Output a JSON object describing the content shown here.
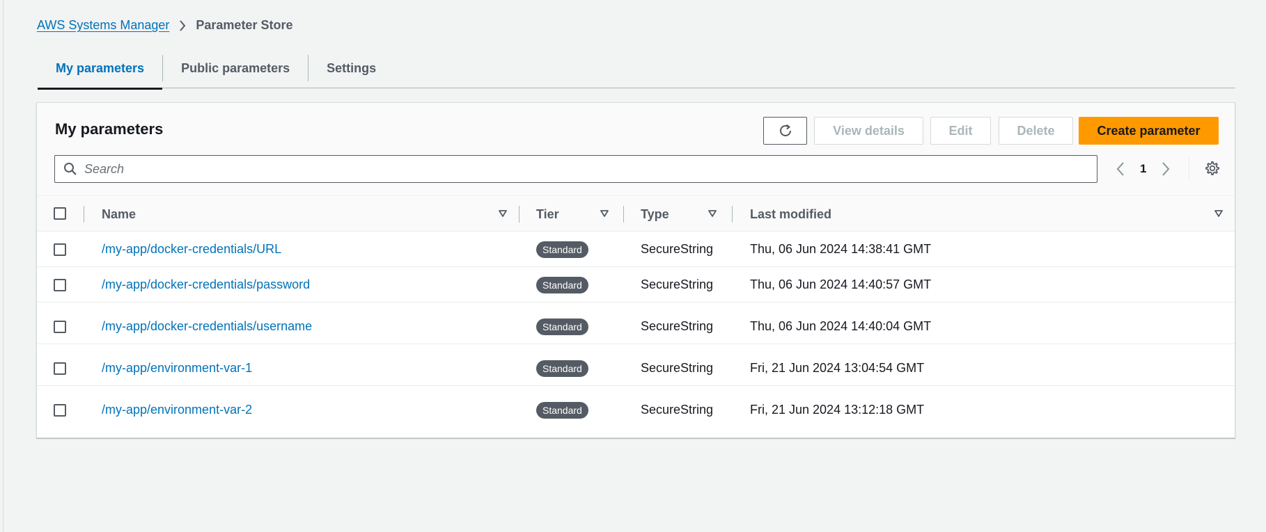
{
  "breadcrumb": {
    "root": "AWS Systems Manager",
    "current": "Parameter Store"
  },
  "tabs": [
    {
      "label": "My parameters",
      "active": true
    },
    {
      "label": "Public parameters",
      "active": false
    },
    {
      "label": "Settings",
      "active": false
    }
  ],
  "panel": {
    "title": "My parameters",
    "buttons": {
      "view": "View details",
      "edit": "Edit",
      "delete": "Delete",
      "create": "Create parameter"
    },
    "search_placeholder": "Search",
    "page": "1"
  },
  "table": {
    "columns": {
      "name": "Name",
      "tier": "Tier",
      "type": "Type",
      "modified": "Last modified"
    },
    "rows": [
      {
        "name": "/my-app/docker-credentials/URL",
        "tier": "Standard",
        "type": "SecureString",
        "modified": "Thu, 06 Jun 2024 14:38:41 GMT"
      },
      {
        "name": "/my-app/docker-credentials/password",
        "tier": "Standard",
        "type": "SecureString",
        "modified": "Thu, 06 Jun 2024 14:40:57 GMT"
      },
      {
        "name": "/my-app/docker-credentials/username",
        "tier": "Standard",
        "type": "SecureString",
        "modified": "Thu, 06 Jun 2024 14:40:04 GMT"
      },
      {
        "name": "/my-app/environment-var-1",
        "tier": "Standard",
        "type": "SecureString",
        "modified": "Fri, 21 Jun 2024 13:04:54 GMT"
      },
      {
        "name": "/my-app/environment-var-2",
        "tier": "Standard",
        "type": "SecureString",
        "modified": "Fri, 21 Jun 2024 13:12:18 GMT"
      }
    ]
  },
  "colors": {
    "accent": "#0073bb",
    "primary_button": "#ff9900",
    "badge": "#545b64",
    "background": "#f2f3f3"
  },
  "icons": [
    "chevron-right-icon",
    "refresh-icon",
    "search-icon",
    "chevron-left-icon",
    "settings-gear-icon",
    "sort-caret-icon"
  ]
}
